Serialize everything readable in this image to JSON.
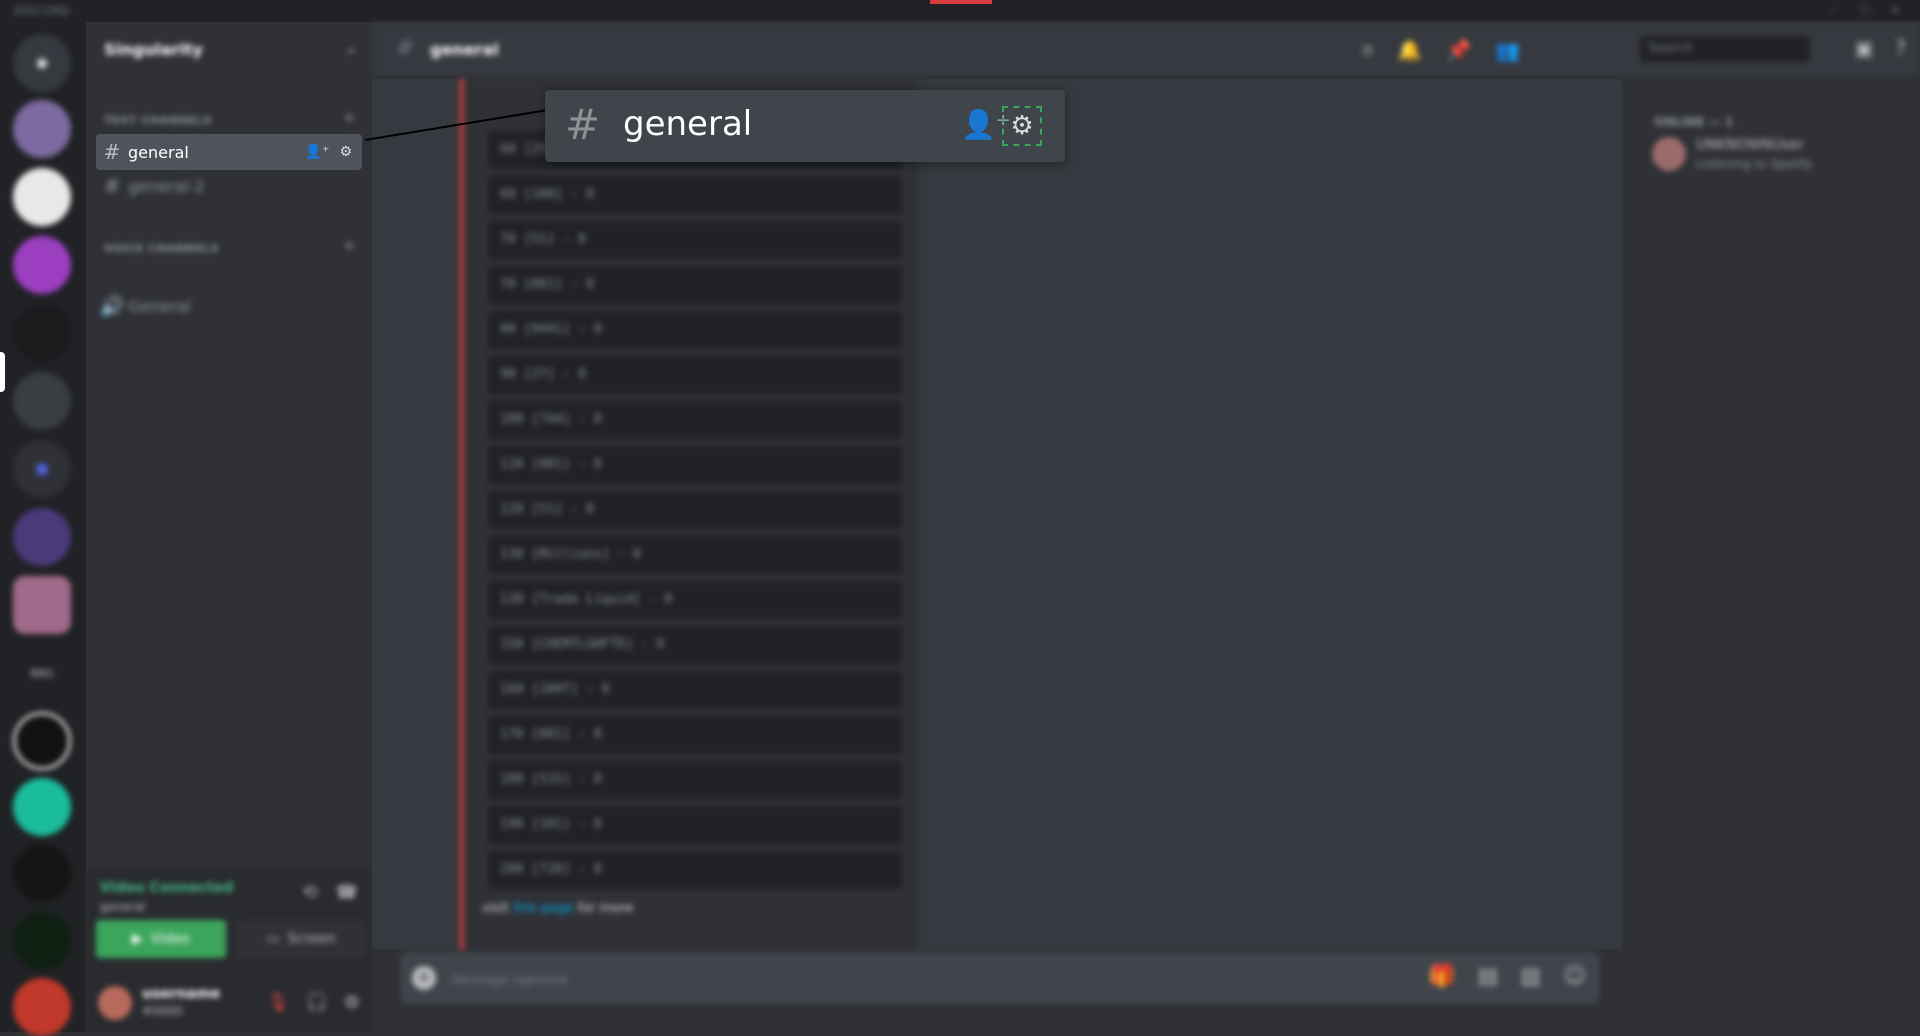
{
  "app": {
    "title": "DISCORD",
    "window_controls": [
      "–",
      "☐",
      "✕"
    ]
  },
  "server_rail": {
    "home_icon": "discord-home-icon",
    "servers": [
      {
        "name": "server-1",
        "color": "#7289da"
      },
      {
        "name": "server-2",
        "color": "#ffffff"
      },
      {
        "name": "server-3",
        "color": "#9b59b6"
      },
      {
        "name": "server-4",
        "color": "#202225"
      },
      {
        "name": "server-5",
        "color": "#36393f"
      },
      {
        "name": "server-6",
        "color": "#3b4cc0"
      },
      {
        "name": "server-7",
        "color": "#5b3b8c"
      },
      {
        "name": "server-8",
        "color": "#a06a8a"
      },
      {
        "name": "server-9",
        "color": "#2f3136"
      },
      {
        "name": "server-10",
        "color": "#ffffff"
      },
      {
        "name": "server-11",
        "color": "#1abc9c"
      },
      {
        "name": "server-12",
        "color": "#2ecc71"
      },
      {
        "name": "server-13",
        "color": "#1f2a1f"
      },
      {
        "name": "server-14",
        "color": "#c0392b"
      }
    ]
  },
  "sidebar": {
    "server_name": "Singularity",
    "text_category": "TEXT CHANNELS",
    "voice_category": "VOICE CHANNELS",
    "channels": [
      {
        "label": "general",
        "active": true
      },
      {
        "label": "general-2",
        "active": false
      }
    ],
    "voice_channels": [
      {
        "label": "General"
      }
    ]
  },
  "voice_panel": {
    "status": "Video Connected",
    "sub": "general",
    "video_label": "Video",
    "screen_label": "Screen"
  },
  "user_panel": {
    "username": "username",
    "tag": "#0000"
  },
  "header": {
    "channel": "general",
    "search_placeholder": "Search"
  },
  "embed": {
    "lines": [
      "60 [25] - 0",
      "60 [100] - 0",
      "70 [51] - 0",
      "70 [081] - 0",
      "80 [9441] - 0",
      "90 [27] - 0",
      "100 [744] - 0",
      "110 [081] - 0",
      "120 [51] - 0",
      "130 [Millions] - 0",
      "130 [Trade Liquid] - 0",
      "150 [CHEMTLGHFTD] - 0",
      "160 [100T] - 0",
      "170 [081] - 0",
      "180 [515] - 0",
      "190 [101] - 0",
      "200 [720] - 0"
    ],
    "footer_prefix": "visit",
    "footer_link": "this page",
    "footer_suffix": "for more"
  },
  "composer": {
    "placeholder": "Message #general"
  },
  "members": {
    "heading": "ONLINE — 1",
    "items": [
      {
        "name": "UNKNOWNUser",
        "activity": "Listening to Spotify"
      }
    ]
  },
  "callout": {
    "channel": "general"
  },
  "colors": {
    "accent_green": "#3ba55c",
    "alert_red": "#d83c3e"
  }
}
